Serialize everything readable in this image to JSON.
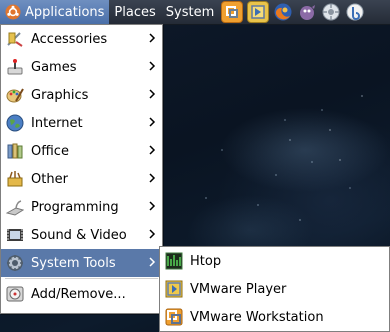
{
  "panel": {
    "menus": [
      "Applications",
      "Places",
      "System"
    ],
    "launchers": [
      "vmware-icon",
      "vmware-player-icon",
      "firefox-icon",
      "pidgin-icon",
      "settings-icon",
      "transmission-icon"
    ]
  },
  "applications_menu": {
    "items": [
      {
        "label": "Accessories",
        "icon": "accessories-icon",
        "submenu": true
      },
      {
        "label": "Games",
        "icon": "games-icon",
        "submenu": true
      },
      {
        "label": "Graphics",
        "icon": "graphics-icon",
        "submenu": true
      },
      {
        "label": "Internet",
        "icon": "internet-icon",
        "submenu": true
      },
      {
        "label": "Office",
        "icon": "office-icon",
        "submenu": true
      },
      {
        "label": "Other",
        "icon": "other-icon",
        "submenu": true
      },
      {
        "label": "Programming",
        "icon": "programming-icon",
        "submenu": true
      },
      {
        "label": "Sound & Video",
        "icon": "sound-video-icon",
        "submenu": true
      },
      {
        "label": "System Tools",
        "icon": "system-tools-icon",
        "submenu": true,
        "highlighted": true
      },
      {
        "label": "Add/Remove...",
        "icon": "add-remove-icon",
        "submenu": false
      }
    ]
  },
  "system_tools_submenu": {
    "items": [
      {
        "label": "Htop",
        "icon": "htop-icon"
      },
      {
        "label": "VMware Player",
        "icon": "vmware-player-icon"
      },
      {
        "label": "VMware Workstation",
        "icon": "vmware-workstation-icon"
      }
    ]
  },
  "colors": {
    "highlight": "#5a79a9",
    "panel": "#2e3642"
  }
}
